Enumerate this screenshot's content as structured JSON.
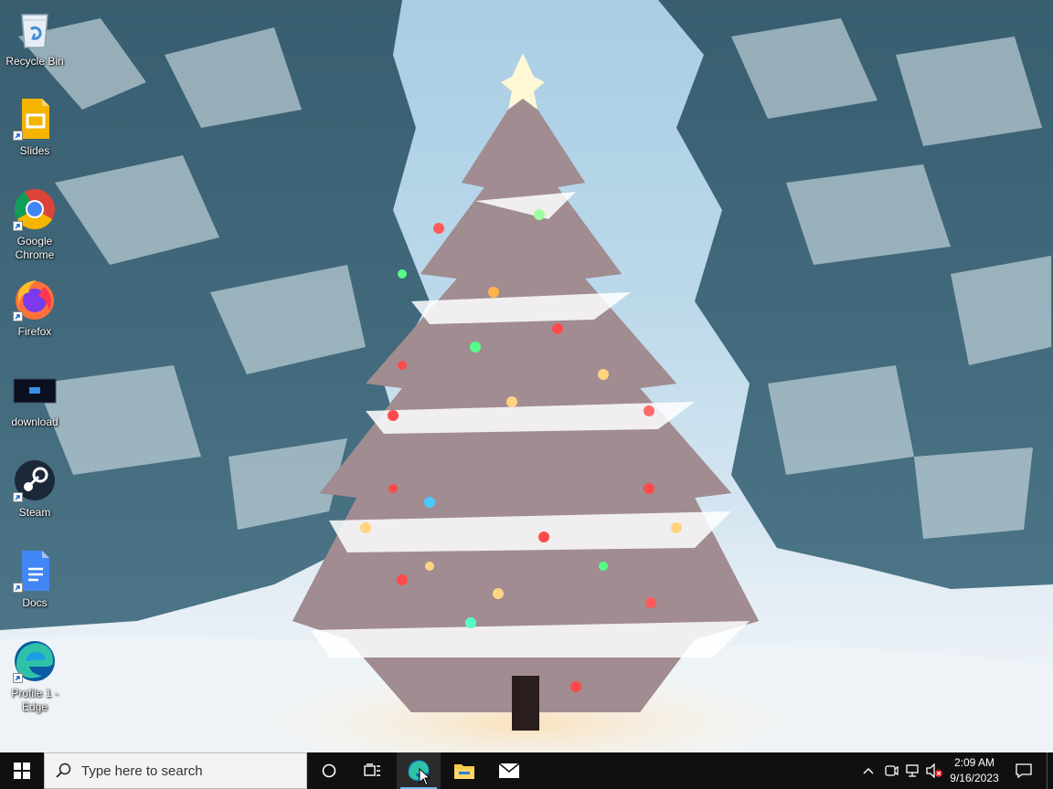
{
  "desktop": {
    "icons": [
      {
        "label": "Recycle Bin",
        "icon": "recycle-bin-icon"
      },
      {
        "label": "Slides",
        "icon": "google-slides-icon"
      },
      {
        "label": "Google Chrome",
        "icon": "chrome-icon"
      },
      {
        "label": "Firefox",
        "icon": "firefox-icon"
      },
      {
        "label": "download",
        "icon": "image-thumbnail-icon"
      },
      {
        "label": "Steam",
        "icon": "steam-icon"
      },
      {
        "label": "Docs",
        "icon": "google-docs-icon"
      },
      {
        "label": "Profile 1 - Edge",
        "icon": "edge-icon"
      }
    ]
  },
  "taskbar": {
    "search_placeholder": "Type here to search",
    "pinned_apps": [
      {
        "name": "Microsoft Edge",
        "icon": "edge-icon",
        "active": true
      },
      {
        "name": "File Explorer",
        "icon": "folder-icon",
        "active": false
      },
      {
        "name": "Mail",
        "icon": "mail-icon",
        "active": false
      }
    ],
    "clock": {
      "time": "2:09 AM",
      "date": "9/16/2023"
    }
  },
  "colors": {
    "taskbar_bg": "#101010",
    "active_indicator": "#76b9ed"
  }
}
